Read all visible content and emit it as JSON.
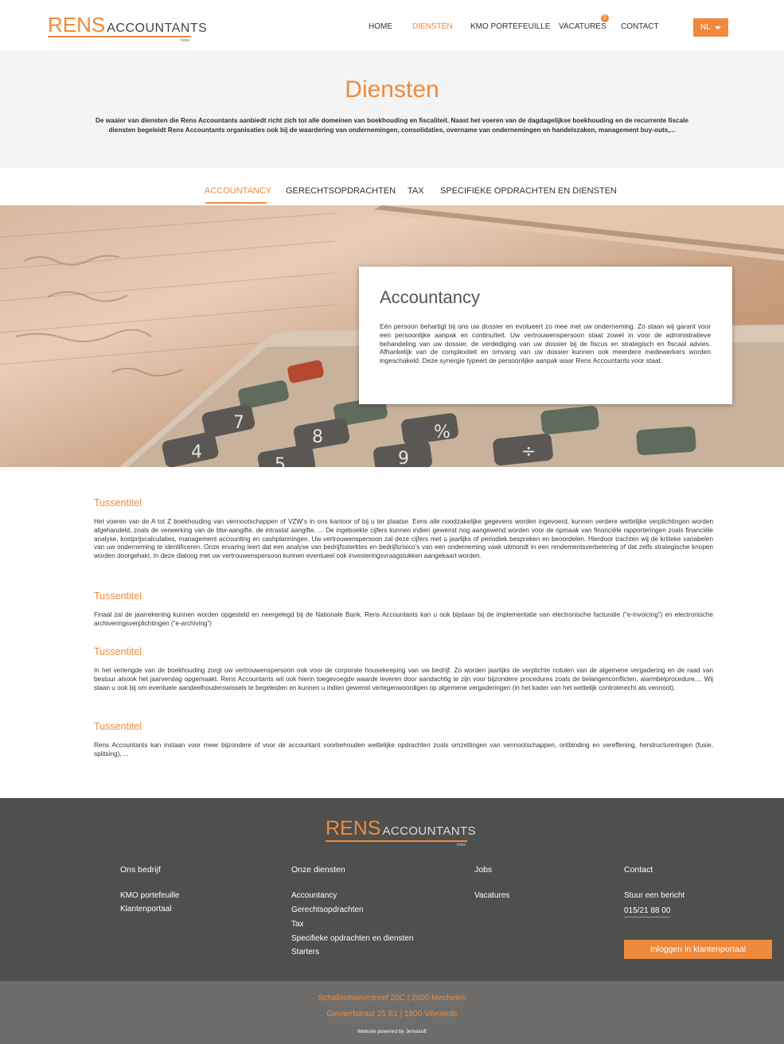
{
  "brand": {
    "name_part1": "RENS",
    "name_part2": "ACCOUNTANTS",
    "suffix": "bvba",
    "accent": "#ef8a3c"
  },
  "nav": {
    "items": [
      {
        "label": "HOME"
      },
      {
        "label": "DIENSTEN"
      },
      {
        "label": "KMO PORTEFEUILLE"
      },
      {
        "label": "VACATURES"
      },
      {
        "label": "CONTACT"
      }
    ],
    "vacatures_badge": "2",
    "language": "NL"
  },
  "hero": {
    "title": "Diensten",
    "intro": "De waaier van diensten die Rens Accountants aanbiedt richt zich tot alle domeinen van boekhouding en fiscaliteit. Naast het voeren van de dagdagelijkse boekhouding en de recurrente fiscale diensten begeleidt Rens Accountants organisaties ook bij de waardering van ondernemingen, consolidaties, overname van ondernemingen en handelszaken, management buy-outs,..."
  },
  "tabs": [
    {
      "label": "ACCOUNTANCY"
    },
    {
      "label": "GERECHTSOPDRACHTEN"
    },
    {
      "label": "TAX"
    },
    {
      "label": "SPECIFIEKE OPDRACHTEN EN DIENSTEN"
    }
  ],
  "card": {
    "title": "Accountancy",
    "text": "Eén persoon behartigt bij ons uw dossier en evolueert zo mee met uw onderneming. Zo staan wij garant voor een persoonlijke aanpak en continuïteit. Uw vertrouwenspersoon staat zowel in voor de administratieve behandeling van uw dossier, de verdediging van uw dossier bij de fiscus en strategisch en fiscaal advies. Afhankelijk van de complexiteit en omvang van uw dossier kunnen ook meerdere medewerkers worden ingeschakeld. Deze synergie typeert de persoonlijke aanpak waar Rens Accountants voor staat."
  },
  "sections": [
    {
      "title": "Tussentitel",
      "text": "Het voeren van de A tot Z boekhouding van vennootschappen of VZW’s in ons kantoor of bij u ter plaatse. Eens alle noodzakelijke gegevens worden ingevoerd, kunnen verdere wettelijke verplichtingen worden afgehandeld, zoals de verwerking van de btw-aangifte, de intrastat aangifte, ... De ingeboekte cijfers kunnen indien gewenst nog aangewend worden voor de opmaak van financiële rapporteringen zoals financiële analyse, kostprijscalculaties, management accounting en cashplanningen. Uw vertrouwenspersoon zal deze cijfers met u jaarlijks of periodiek bespreken en beoordelen. Hierdoor trachten wij de kritieke variabelen van uw onderneming te identificeren. Onze ervaring leert dat een analyse van bedrijfssterktes en bedrijfsrisico’s van een onderneming vaak uitmondt in een rendementsverbetering of dat zelfs strategische knopen worden doorgehakt. In deze dialoog met uw vertrouwenspersoon kunnen eventueel ook investeringsvraagstukken aangekaart worden."
    },
    {
      "title": "Tussentitel",
      "text": "Finaal zal de jaarrekening kunnen worden opgesteld en neergelegd bij de Nationale Bank. Rens Accountants kan u ook bijstaan bij de implementatie van electronische facturatie (“e-invoicing”) en electronische archiveringsverplichtingen (“e-archiving”)"
    },
    {
      "title": "Tussentitel",
      "text": "In het verlengde van de boekhouding zorgt uw vertrouwenspersoon ook voor de corporate housekeeping van uw bedrijf. Zo worden jaarlijks de verplichte notulen van de algemene vergadering en de raad van bestuur alsook het jaarverslag opgemaakt. Rens Accountants wil ook hierin toegevoegde waarde leveren door aandachtig te zijn voor bijzondere procedures zoals de belangenconflicten, alarmbelprocedure,... Wij staan u ook bij om eventuele aandeelhouderswissels te begeleiden en kunnen u indien gewenst vertegenwoordigen op algemene vergaderingen (in het kader van het wettelijk controlerecht als vennoot)."
    },
    {
      "title": "Tussentitel",
      "text": "Rens Accountants kan instaan voor meer bijzondere of voor de accountant voorbehouden wettelijke opdrachten zoals omzettingen van vennootschappen, ontbinding en vereffening, herstructureringen (fusie, splitsing), ..."
    }
  ],
  "footer": {
    "col1": {
      "head": "Ons bedrijf",
      "items": [
        "KMO portefeuille",
        "Klantenportaal"
      ]
    },
    "col2": {
      "head": "Onze diensten",
      "items": [
        "Accountancy",
        "Gerechtsopdrachten",
        "Tax",
        "Specifieke opdrachten en diensten",
        "Starters"
      ]
    },
    "col3": {
      "head": "Jobs",
      "items": [
        "Vacatures"
      ]
    },
    "col4": {
      "head": "Contact",
      "items": [
        "Stuur een bericht",
        "015/21 88 00"
      ]
    },
    "login_button": "Inloggen in klantenportaal",
    "address1": "Schaliënhoevedreef 20C | 2800 Mechelen",
    "address2": "Gevaertstraat 25 B1 | 1800 Vilvoorde",
    "powered": "Website powered by Jemasoft"
  }
}
